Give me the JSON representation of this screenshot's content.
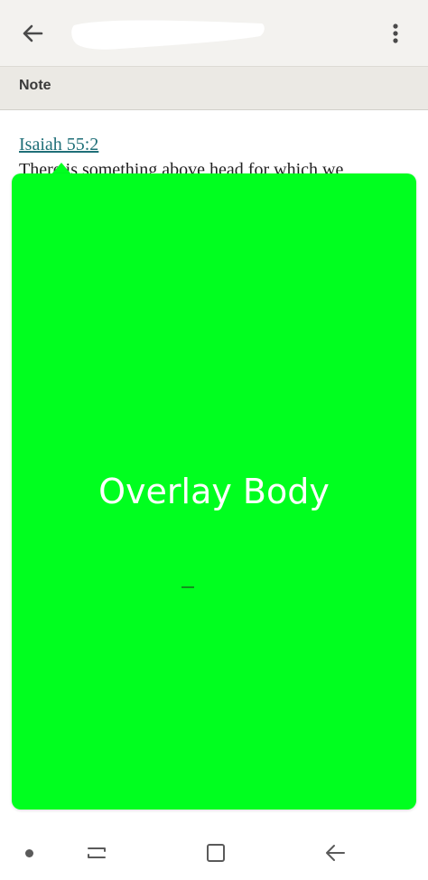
{
  "app_bar": {
    "back_icon": "arrow-left-icon",
    "more_icon": "more-vert-icon",
    "title_redacted": true
  },
  "section": {
    "title": "Note"
  },
  "note": {
    "verse_reference": "Isaiah 55:2",
    "body_text": "There is something above head for which we"
  },
  "overlay": {
    "label": "Overlay Body",
    "color": "#00ff1f"
  },
  "system_nav": {
    "items": [
      "dot-indicator",
      "recents-icon",
      "home-icon",
      "back-icon"
    ]
  },
  "colors": {
    "app_bar_bg": "#f3f2ef",
    "section_bg": "#ebe9e4",
    "link": "#1f6f78",
    "overlay": "#00ff1f"
  }
}
